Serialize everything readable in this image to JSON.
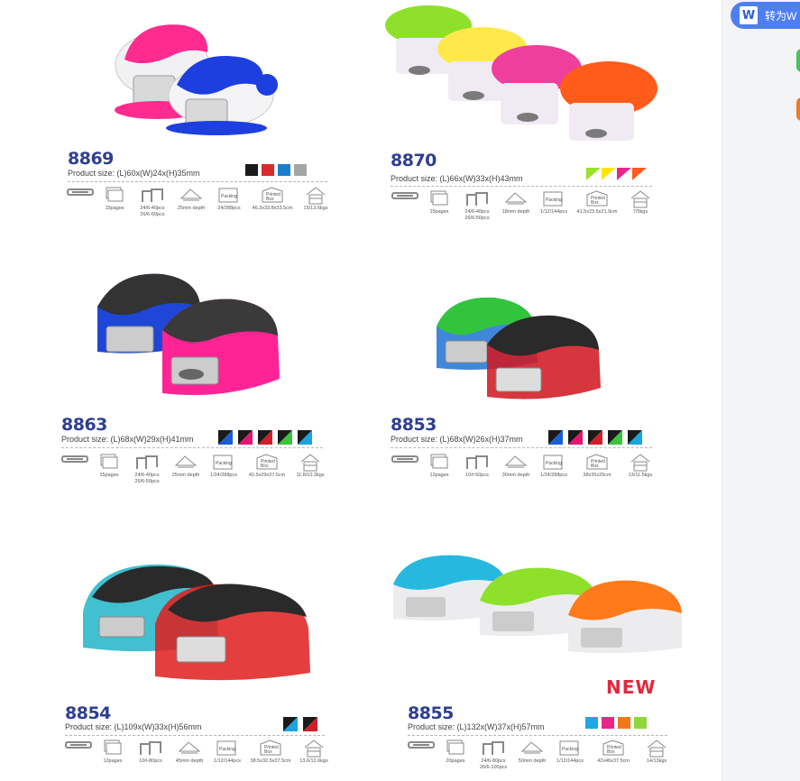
{
  "toolbar": {
    "convert_label": "转为W",
    "convert_icon": "word-icon"
  },
  "products": [
    {
      "id": "8869",
      "model": "8869",
      "size": "Product size: (L)60x(W)24x(H)35mm",
      "colors": [
        "#1a1a1a",
        "#d92b2b",
        "#1a7fc9",
        "#a5a5a5"
      ],
      "specs": {
        "staple": "",
        "pages": "15pages",
        "staples": "24/6-40pcs\n26/6-60pcs",
        "depth": "25mm depth",
        "packing": "24/288pcs",
        "box": "46.3x33.8x33.5cm",
        "weight": "15/13.6kgs"
      }
    },
    {
      "id": "8870",
      "model": "8870",
      "size": "Product size: (L)66x(W)33x(H)43mm",
      "colors": [
        "#9be02a",
        "#ffe600",
        "#e8268a",
        "#ff5a1f"
      ],
      "specs": {
        "staple": "",
        "pages": "15pages",
        "staples": "24/6-40pcs\n26/6-50pcs",
        "depth": "18mm depth",
        "packing": "1/12/144pcs",
        "box": "41.5x23.5x21.9cm",
        "weight": "7/5kgs"
      }
    },
    {
      "id": "8863",
      "model": "8863",
      "size": "Product size: (L)68x(W)29x(H)41mm",
      "colors": [
        "#1a5fd6",
        "#e3166f",
        "#d11f2a",
        "#3cc43c",
        "#1aa5e0"
      ],
      "specs": {
        "staple": "",
        "pages": "15pages",
        "staples": "24/6-40pcs\n26/6-50pcs",
        "depth": "25mm depth",
        "packing": "1/24/288pcs",
        "box": "42.5x29x37.5cm",
        "weight": "11.8/10.3kgs"
      }
    },
    {
      "id": "8853",
      "model": "8853",
      "size": "Product size: (L)68x(W)26x(H)37mm",
      "colors": [
        "#1a5fd6",
        "#e3166f",
        "#d11f2a",
        "#3cc43c",
        "#1aa5e0"
      ],
      "specs": {
        "staple": "",
        "pages": "12pages",
        "staples": "10#-50pcs",
        "depth": "30mm depth",
        "packing": "1/24/288pcs",
        "box": "38x35x25cm",
        "weight": "13/11.5kgs"
      }
    },
    {
      "id": "8854",
      "model": "8854",
      "size": "Product size: (L)109x(W)33x(H)56mm",
      "colors": [
        "#1aa5e0",
        "#d11f2a"
      ],
      "specs": {
        "staple": "",
        "pages": "12pages",
        "staples": "10#-80pcs",
        "depth": "45mm depth",
        "packing": "1/12/144pcs",
        "box": "38.5x32.5x37.5cm",
        "weight": "13.6/12.6kgs"
      }
    },
    {
      "id": "8855",
      "model": "8855",
      "size": "Product size: (L)132x(W)37x(H)57mm",
      "colors": [
        "#1ea6e6",
        "#e8268a",
        "#f07a1a",
        "#8fd63a"
      ],
      "specs": {
        "staple": "",
        "pages": "20pages",
        "staples": "24/6-80pcs\n26/6-100pcs",
        "depth": "50mm depth",
        "packing": "1/12/144pcs",
        "box": "42x46x37.5cm",
        "weight": "14/13kgs"
      }
    }
  ],
  "icon_labels": {
    "packing": "Packing",
    "printed_box": "Printed\nBox"
  },
  "new_tag": "NEW"
}
